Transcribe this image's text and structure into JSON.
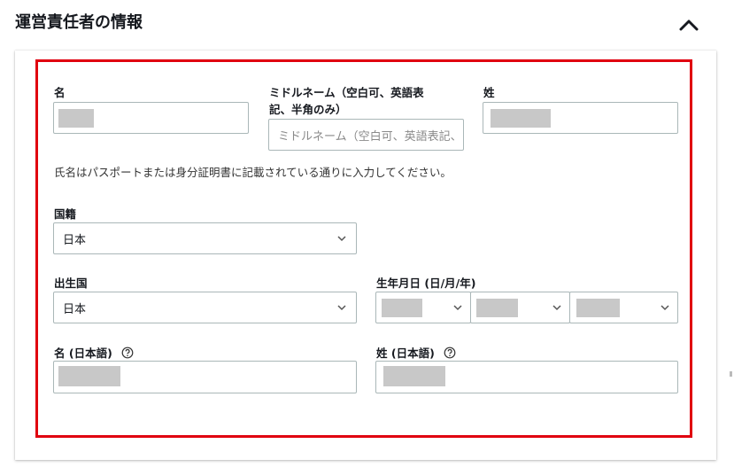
{
  "section": {
    "title": "運営責任者の情報",
    "collapse_icon": "chevron-up-icon"
  },
  "form": {
    "first_name": {
      "label": "名",
      "value_redacted": true
    },
    "middle_name": {
      "label_line1": "ミドルネーム（空白可、英語表",
      "label_line2": "記、半角のみ）",
      "placeholder": "ミドルネーム（空白可、英語表記、半角のみ）"
    },
    "last_name": {
      "label": "姓",
      "value_redacted": true
    },
    "hint": "氏名はパスポートまたは身分証明書に記載されている通りに入力してください。",
    "nationality": {
      "label": "国籍",
      "value": "日本"
    },
    "birth_country": {
      "label": "出生国",
      "value": "日本"
    },
    "birth_date": {
      "label": "生年月日 (日/月/年)",
      "day_redacted": true,
      "month_redacted": true,
      "year_redacted": true
    },
    "first_name_ja": {
      "label": "名 (日本語)",
      "help_icon": "question-circle-icon",
      "value_redacted": true
    },
    "last_name_ja": {
      "label": "姓 (日本語)",
      "help_icon": "question-circle-icon",
      "value_redacted": true
    }
  },
  "colors": {
    "highlight_border": "#e0000f",
    "redaction": "#c8c8c8",
    "input_border": "#aab7b8"
  }
}
